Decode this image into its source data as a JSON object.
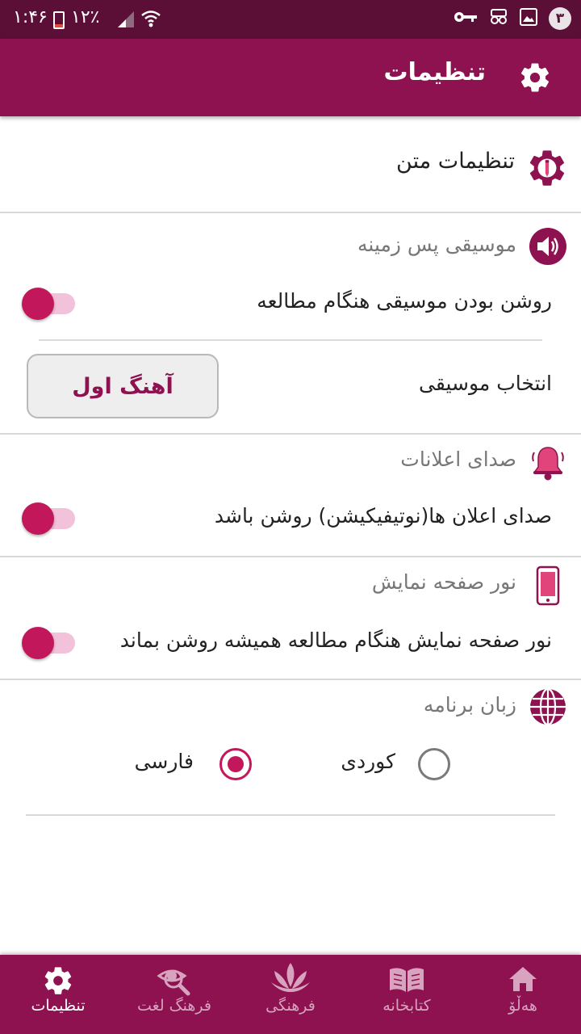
{
  "status_bar": {
    "time": "۱:۴۶",
    "battery_percent": "۱۲٪",
    "notification_count": "۳"
  },
  "app_bar": {
    "title": "تنظیمات"
  },
  "text_settings": {
    "label": "تنظیمات متن"
  },
  "background_music": {
    "title": "موسیقی پس زمینه",
    "toggle_label": "روشن بودن موسیقی هنگام مطالعه",
    "select_label": "انتخاب موسیقی",
    "select_button": "آهنگ اول"
  },
  "notification_sound": {
    "title": "صدای اعلانات",
    "toggle_label": "صدای اعلان ها(نوتیفیکیشن) روشن باشد"
  },
  "screen_light": {
    "title": "نور صفحه نمایش",
    "toggle_label": "نور صفحه نمایش هنگام مطالعه همیشه روشن بماند"
  },
  "app_language": {
    "title": "زبان برنامه",
    "options": [
      {
        "label": "کوردی",
        "selected": false
      },
      {
        "label": "فارسی",
        "selected": true
      }
    ]
  },
  "bottom_nav": {
    "items": [
      {
        "label": "هەڵۆ",
        "icon": "home-icon",
        "active": false
      },
      {
        "label": "کتابخانه",
        "icon": "book-icon",
        "active": false
      },
      {
        "label": "فرهنگی",
        "icon": "lotus-icon",
        "active": false
      },
      {
        "label": "فرهنگ لغت",
        "icon": "dictionary-search-icon",
        "active": false
      },
      {
        "label": "تنظیمات",
        "icon": "gear-icon",
        "active": true
      }
    ]
  },
  "colors": {
    "primary": "#8e1150",
    "status_bar": "#5b0f36",
    "accent": "#c2185b"
  }
}
